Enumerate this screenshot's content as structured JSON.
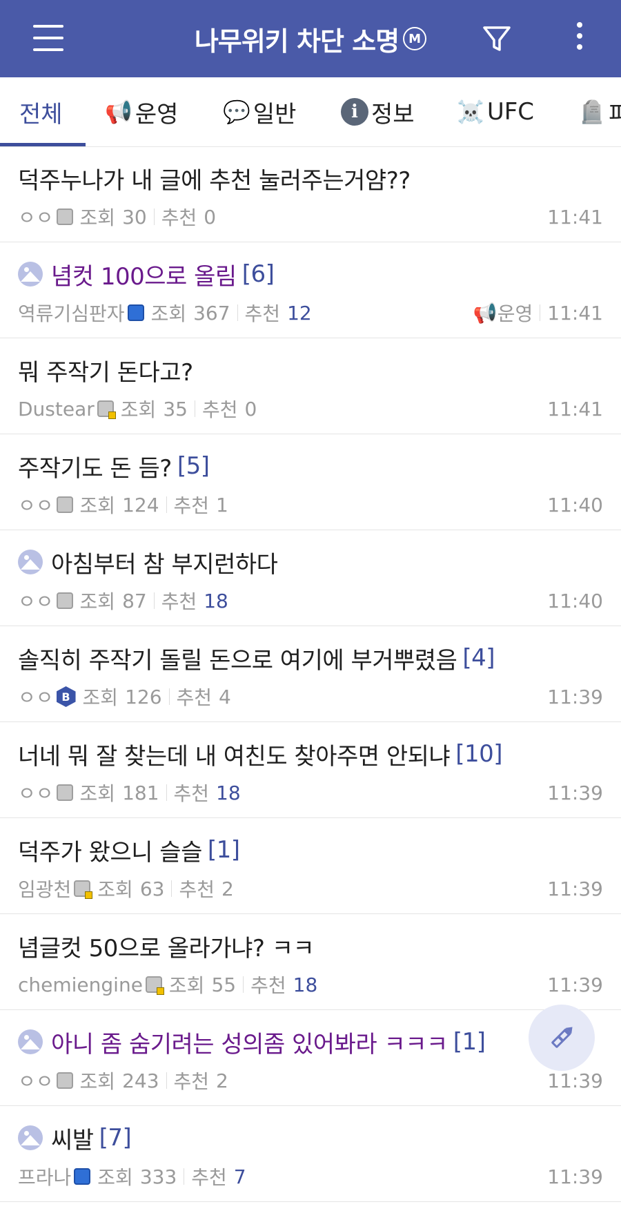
{
  "header": {
    "title": "나무위키 차단 소명",
    "badge": "M",
    "menu_icon": "hamburger-icon",
    "filter_icon": "filter-icon",
    "more_icon": "more-vertical-icon",
    "bg_color": "#4a5aa8"
  },
  "tabs": [
    {
      "label": "전체",
      "icon": ""
    },
    {
      "label": "운영",
      "icon": "📢"
    },
    {
      "label": "일반",
      "icon": "💬"
    },
    {
      "label": "정보",
      "icon": "i"
    },
    {
      "label": "UFC",
      "icon": "☠️"
    },
    {
      "label": "피",
      "icon": "🪦"
    }
  ],
  "labels": {
    "views": "조회",
    "recommend": "추천"
  },
  "posts": [
    {
      "title": "덕주누나가 내 글에 추천 눌러주는거얌??",
      "comments": "",
      "author": "ㅇㅇ",
      "views": "30",
      "recommend": "0",
      "time": "11:41",
      "category": "",
      "has_image": false,
      "notice": false
    },
    {
      "title": "념컷 100으로 올림",
      "comments": "[6]",
      "author": "역류기심판자",
      "views": "367",
      "recommend": "12",
      "time": "11:41",
      "category": "운영",
      "has_image": true,
      "notice": true
    },
    {
      "title": "뭐 주작기 돈다고?",
      "comments": "",
      "author": "Dustear",
      "views": "35",
      "recommend": "0",
      "time": "11:41",
      "category": "",
      "has_image": false,
      "notice": false
    },
    {
      "title": "주작기도 돈 듬?",
      "comments": "[5]",
      "author": "ㅇㅇ",
      "views": "124",
      "recommend": "1",
      "time": "11:40",
      "category": "",
      "has_image": false,
      "notice": false
    },
    {
      "title": "아침부터 참 부지런하다",
      "comments": "",
      "author": "ㅇㅇ",
      "views": "87",
      "recommend": "18",
      "time": "11:40",
      "category": "",
      "has_image": true,
      "notice": false
    },
    {
      "title": "솔직히 주작기 돌릴 돈으로 여기에 부거뿌렸음",
      "comments": "[4]",
      "author": "ㅇㅇ",
      "views": "126",
      "recommend": "4",
      "time": "11:39",
      "category": "",
      "has_image": false,
      "notice": false
    },
    {
      "title": "너네 뭐 잘 찾는데 내 여친도 찾아주면 안되냐",
      "comments": "[10]",
      "author": "ㅇㅇ",
      "views": "181",
      "recommend": "18",
      "time": "11:39",
      "category": "",
      "has_image": false,
      "notice": false
    },
    {
      "title": "덕주가 왔으니 슬슬",
      "comments": "[1]",
      "author": "임광천",
      "views": "63",
      "recommend": "2",
      "time": "11:39",
      "category": "",
      "has_image": false,
      "notice": false
    },
    {
      "title": "념글컷 50으로 올라가냐? ㅋㅋ",
      "comments": "",
      "author": "chemiengine",
      "views": "55",
      "recommend": "18",
      "time": "11:39",
      "category": "",
      "has_image": false,
      "notice": false
    },
    {
      "title": "아니 좀 숨기려는 성의좀 있어봐라 ㅋㅋㅋ",
      "comments": "[1]",
      "author": "ㅇㅇ",
      "views": "243",
      "recommend": "2",
      "time": "11:39",
      "category": "",
      "has_image": true,
      "notice": true
    },
    {
      "title": "씨발",
      "comments": "[7]",
      "author": "프라나",
      "views": "333",
      "recommend": "7",
      "time": "11:39",
      "category": "",
      "has_image": true,
      "notice": false
    }
  ],
  "fab": {
    "icon": "write-pencil-icon"
  }
}
